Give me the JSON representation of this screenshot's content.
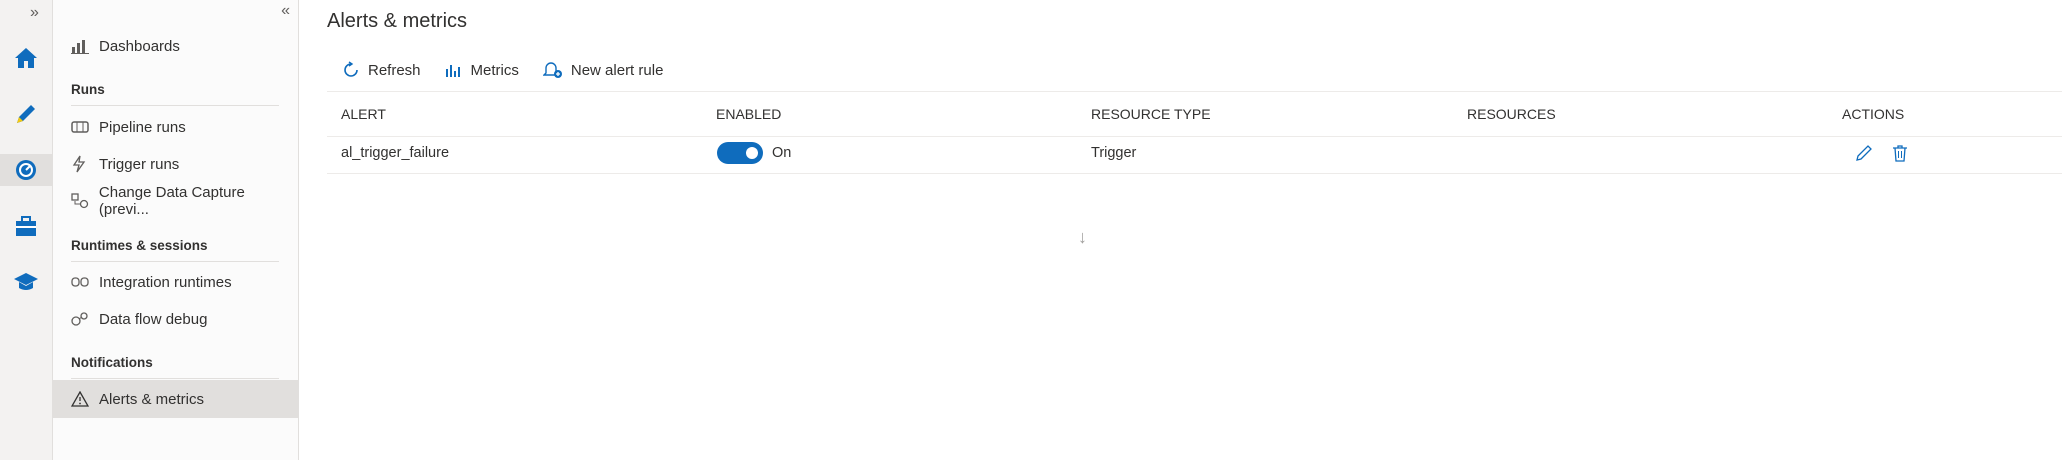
{
  "rail": {
    "expand_glyph": "»",
    "icons": [
      "home-icon",
      "pencil-icon",
      "monitor-gauge-icon",
      "toolbox-icon",
      "graduation-cap-icon"
    ]
  },
  "sidebar": {
    "collapse_glyph": "«",
    "top_item": {
      "label": "Dashboards",
      "icon": "dashboards-icon"
    },
    "sections": [
      {
        "title": "Runs",
        "items": [
          {
            "label": "Pipeline runs",
            "icon": "pipeline-runs-icon"
          },
          {
            "label": "Trigger runs",
            "icon": "trigger-runs-icon"
          },
          {
            "label": "Change Data Capture (previ...",
            "icon": "change-data-capture-icon"
          }
        ]
      },
      {
        "title": "Runtimes & sessions",
        "items": [
          {
            "label": "Integration runtimes",
            "icon": "integration-runtimes-icon"
          },
          {
            "label": "Data flow debug",
            "icon": "data-flow-debug-icon"
          }
        ]
      },
      {
        "title": "Notifications",
        "items": [
          {
            "label": "Alerts & metrics",
            "icon": "warning-triangle-icon",
            "selected": true
          }
        ]
      }
    ]
  },
  "main": {
    "title": "Alerts & metrics",
    "toolbar": {
      "refresh": "Refresh",
      "metrics": "Metrics",
      "new_alert_rule": "New alert rule"
    },
    "table": {
      "headers": [
        "ALERT",
        "ENABLED",
        "RESOURCE TYPE",
        "RESOURCES",
        "ACTIONS"
      ],
      "rows": [
        {
          "alert": "al_trigger_failure",
          "enabled": true,
          "enabled_label": "On",
          "resource_type": "Trigger",
          "resources": ""
        }
      ]
    }
  },
  "colors": {
    "accent": "#0f6cbd",
    "rail_bg": "#f3f2f1",
    "selected_bg": "#e1dfdd"
  }
}
